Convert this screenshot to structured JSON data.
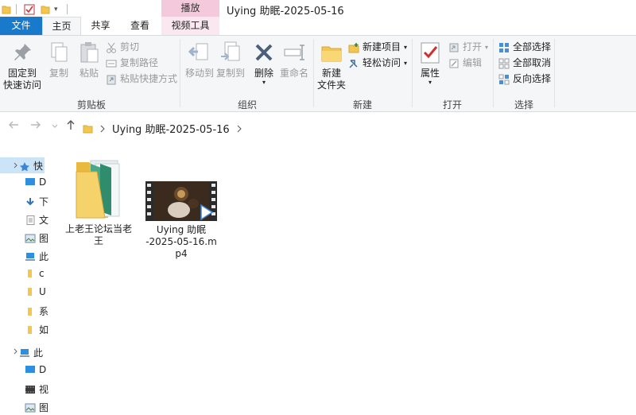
{
  "window": {
    "title": "Uying 助眠-2025-05-16",
    "context_tab": "播放",
    "quick_access_dropdown": "▾"
  },
  "tabs": {
    "file": "文件",
    "home": "主页",
    "share": "共享",
    "view": "查看",
    "video_tools": "视频工具"
  },
  "ribbon": {
    "clipboard": {
      "group_label": "剪贴板",
      "pin_label_1": "固定到",
      "pin_label_2": "快速访问",
      "copy": "复制",
      "paste": "粘贴",
      "cut": "剪切",
      "copy_path": "复制路径",
      "paste_shortcut": "粘贴快捷方式"
    },
    "organize": {
      "group_label": "组织",
      "move_to": "移动到",
      "copy_to": "复制到",
      "delete": "删除",
      "rename": "重命名"
    },
    "new": {
      "group_label": "新建",
      "new_folder_1": "新建",
      "new_folder_2": "文件夹",
      "new_item": "新建项目",
      "easy_access": "轻松访问"
    },
    "open": {
      "group_label": "打开",
      "properties": "属性",
      "open": "打开",
      "edit": "编辑"
    },
    "select": {
      "group_label": "选择",
      "select_all": "全部选择",
      "select_none": "全部取消",
      "invert": "反向选择"
    }
  },
  "address": {
    "crumbs": [
      "Uying 助眠-2025-05-16"
    ]
  },
  "navpane": {
    "items": [
      {
        "label": "快",
        "icon": "star-icon"
      },
      {
        "label": "D",
        "icon": "desktop-icon"
      },
      {
        "label": "下",
        "icon": "download-icon"
      },
      {
        "label": "文",
        "icon": "document-icon"
      },
      {
        "label": "图",
        "icon": "picture-icon"
      },
      {
        "label": "此",
        "icon": "pc-icon"
      },
      {
        "label": "c",
        "icon": "folder-icon"
      },
      {
        "label": "U",
        "icon": "folder-icon"
      },
      {
        "label": "系",
        "icon": "folder-icon"
      },
      {
        "label": "如",
        "icon": "folder-icon"
      },
      {
        "label": "此",
        "icon": "pc-icon"
      },
      {
        "label": "D",
        "icon": "desktop-icon"
      },
      {
        "label": "视",
        "icon": "video-icon"
      },
      {
        "label": "图",
        "icon": "picture-icon"
      }
    ]
  },
  "files": [
    {
      "name_line1": "上老王论坛当老",
      "name_line2": "王",
      "name_line3": "",
      "type": "folder"
    },
    {
      "name_line1": "Uying 助眠",
      "name_line2": "-2025-05-16.m",
      "name_line3": "p4",
      "type": "video"
    }
  ],
  "colors": {
    "file_tab": "#1979ca",
    "context_tab": "#f4c9db",
    "selection": "#cce4f7",
    "folder_yellow": "#f3c74f"
  }
}
